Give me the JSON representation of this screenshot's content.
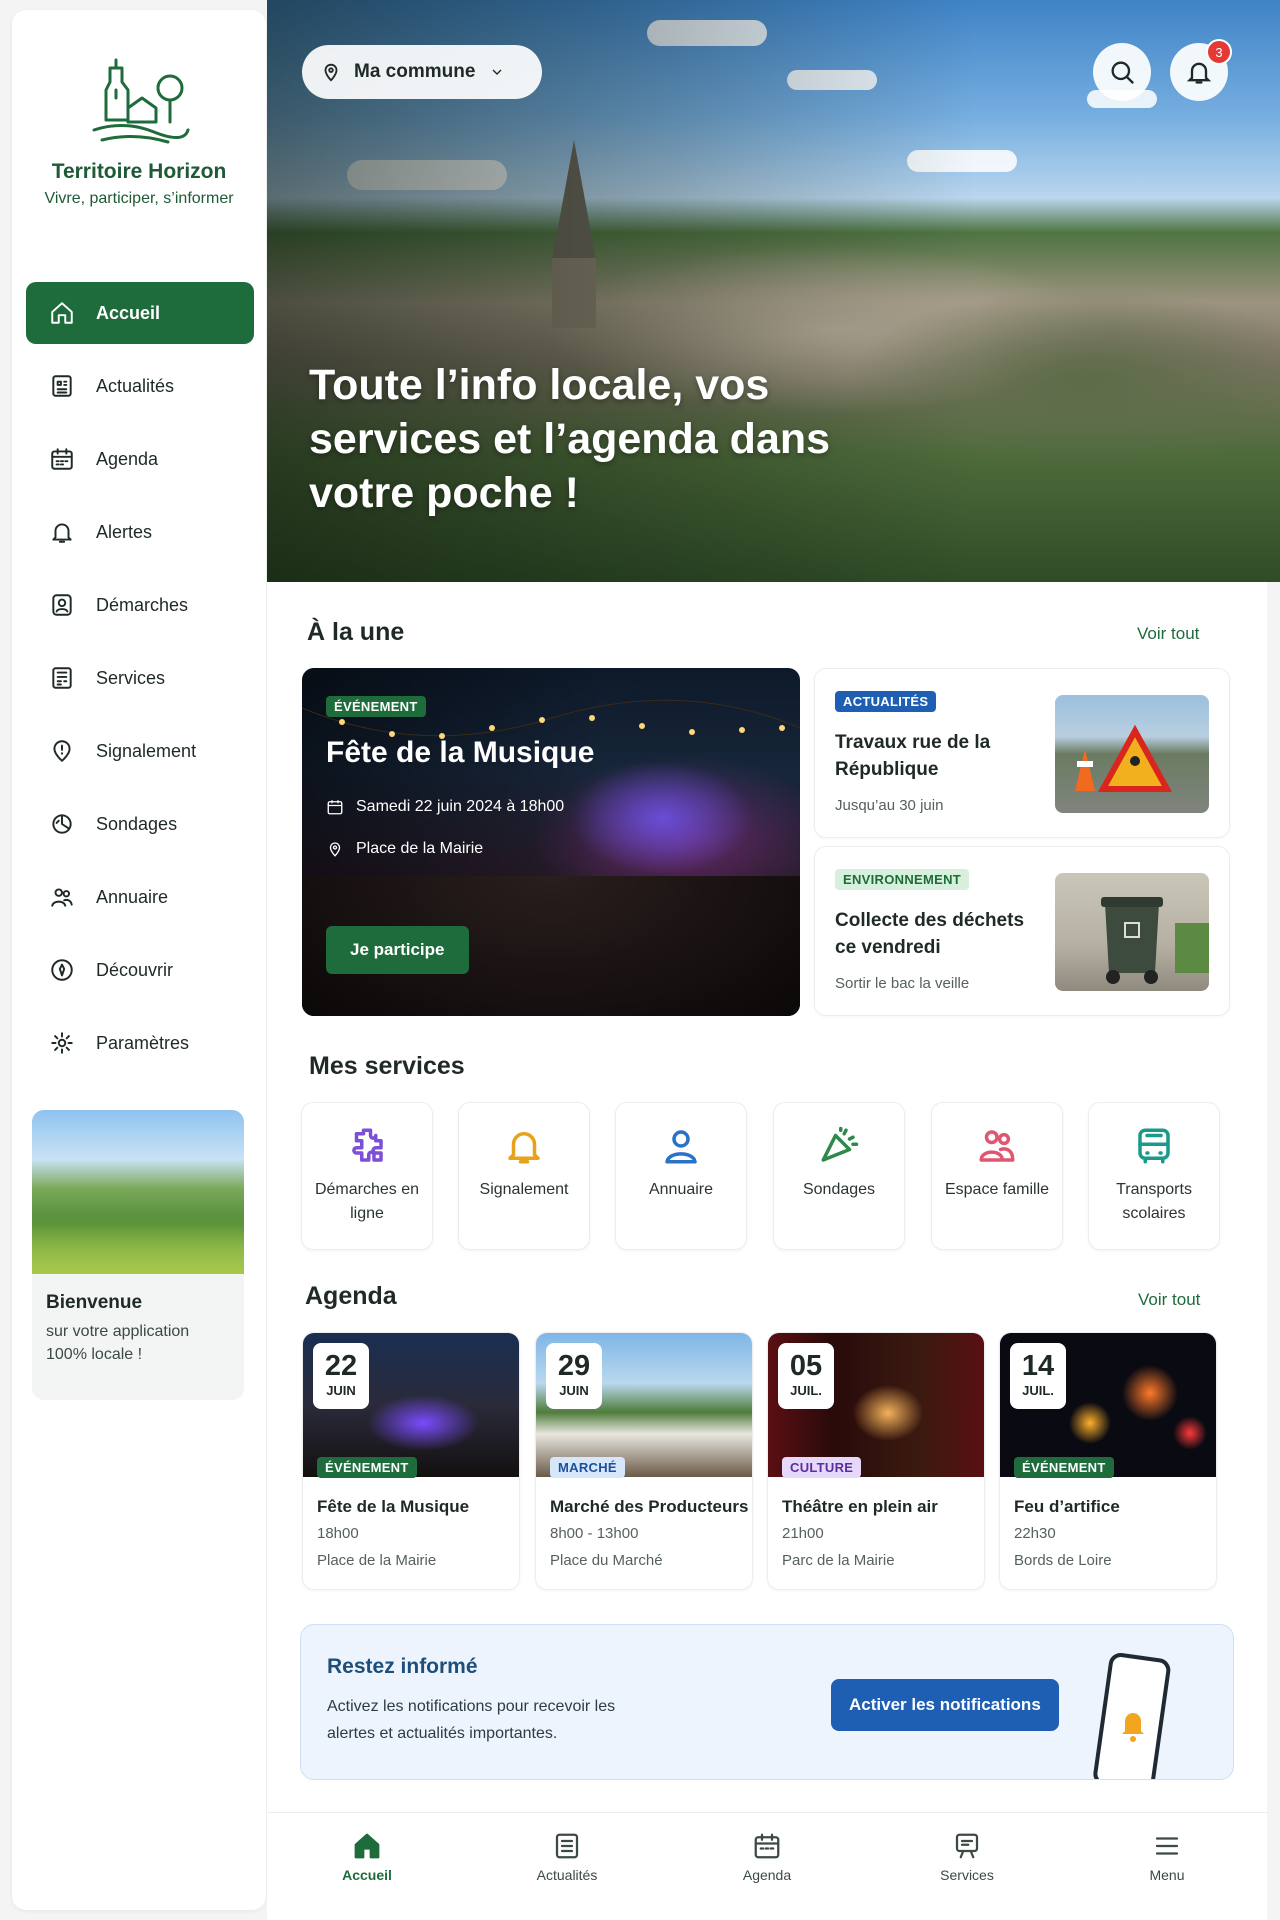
{
  "brand": {
    "name": "Territoire Horizon",
    "tagline": "Vivre, participer, s’informer"
  },
  "sidebar": {
    "items": [
      {
        "label": "Accueil",
        "icon": "home-icon",
        "active": true
      },
      {
        "label": "Actualités",
        "icon": "news-icon"
      },
      {
        "label": "Agenda",
        "icon": "calendar-icon"
      },
      {
        "label": "Alertes",
        "icon": "bell-icon"
      },
      {
        "label": "Démarches",
        "icon": "procedures-icon"
      },
      {
        "label": "Services",
        "icon": "services-icon"
      },
      {
        "label": "Signalement",
        "icon": "report-icon"
      },
      {
        "label": "Sondages",
        "icon": "poll-icon"
      },
      {
        "label": "Annuaire",
        "icon": "directory-icon"
      },
      {
        "label": "Découvrir",
        "icon": "discover-icon"
      },
      {
        "label": "Paramètres",
        "icon": "gear-icon"
      }
    ],
    "welcome": {
      "title": "Bienvenue",
      "text": "sur votre application 100% locale !"
    }
  },
  "header": {
    "commune": "Ma commune",
    "notification_count": "3",
    "hero_title": "Toute l’info locale, vos services et l’agenda dans votre poche !"
  },
  "une": {
    "title": "À la une",
    "see_all": "Voir tout",
    "feature": {
      "tag": "ÉVÉNEMENT",
      "title": "Fête de la Musique",
      "date": "Samedi 22 juin 2024 à 18h00",
      "place": "Place de la Mairie",
      "cta": "Je participe"
    },
    "news": [
      {
        "tag": "ACTUALITÉS",
        "title": "Travaux rue de la République",
        "sub": "Jusqu’au 30 juin"
      },
      {
        "tag": "ENVIRONNEMENT",
        "title": "Collecte des déchets ce vendredi",
        "sub": "Sortir le bac la veille"
      }
    ]
  },
  "services": {
    "title": "Mes services",
    "items": [
      {
        "label": "Démarches en ligne",
        "color": "#7b4fd6"
      },
      {
        "label": "Signalement",
        "color": "#e8a21a"
      },
      {
        "label": "Annuaire",
        "color": "#2a72c8"
      },
      {
        "label": "Sondages",
        "color": "#2e8a4a"
      },
      {
        "label": "Espace famille",
        "color": "#e05670"
      },
      {
        "label": "Transports scolaires",
        "color": "#1a9a8a"
      }
    ]
  },
  "agenda": {
    "title": "Agenda",
    "see_all": "Voir tout",
    "events": [
      {
        "day": "22",
        "month": "JUIN",
        "tag": "ÉVÉNEMENT",
        "title": "Fête de la Musique",
        "time": "18h00",
        "place": "Place de la Mairie"
      },
      {
        "day": "29",
        "month": "JUIN",
        "tag": "MARCHÉ",
        "title": "Marché des Producteurs",
        "time": "8h00 - 13h00",
        "place": "Place du Marché"
      },
      {
        "day": "05",
        "month": "JUIL.",
        "tag": "CULTURE",
        "title": "Théâtre en plein air",
        "time": "21h00",
        "place": "Parc de la Mairie"
      },
      {
        "day": "14",
        "month": "JUIL.",
        "tag": "ÉVÉNEMENT",
        "title": "Feu d’artifice",
        "time": "22h30",
        "place": "Bords de Loire"
      }
    ]
  },
  "notify": {
    "title": "Restez informé",
    "text": "Activez les notifications pour recevoir les alertes et actualités importantes.",
    "button": "Activer les notifications"
  },
  "bottom_nav": [
    {
      "label": "Accueil",
      "active": true
    },
    {
      "label": "Actualités"
    },
    {
      "label": "Agenda"
    },
    {
      "label": "Services"
    },
    {
      "label": "Menu"
    }
  ]
}
